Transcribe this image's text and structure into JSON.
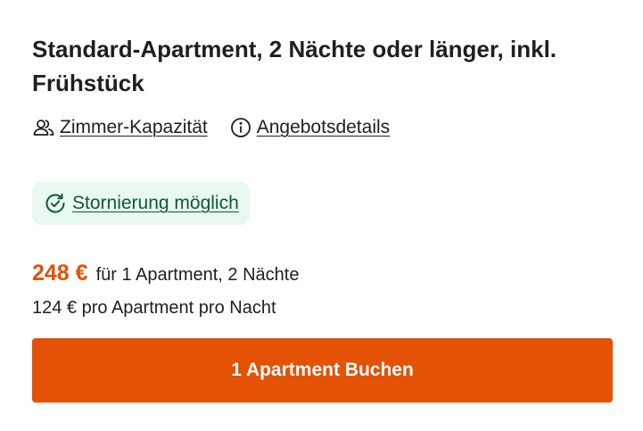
{
  "offer": {
    "title": "Standard-Apartment, 2 Nächte oder länger, inkl. Frühstück"
  },
  "links": {
    "capacity_label": "Zimmer-Kapazität",
    "capacity_icon": "people-icon",
    "details_label": "Angebotsdetails",
    "details_icon": "info-icon"
  },
  "cancellation": {
    "label": "Stornierung möglich",
    "icon": "refresh-check-icon",
    "badge_color": "#e9f9ef",
    "text_color": "#0f5a33"
  },
  "price": {
    "total": "248 €",
    "total_description": "für 1 Apartment, 2 Nächte",
    "per_night": "124 € pro Apartment pro Nacht",
    "accent_color": "#e35205"
  },
  "action": {
    "book_label": "1 Apartment Buchen",
    "button_color": "#e35205"
  }
}
